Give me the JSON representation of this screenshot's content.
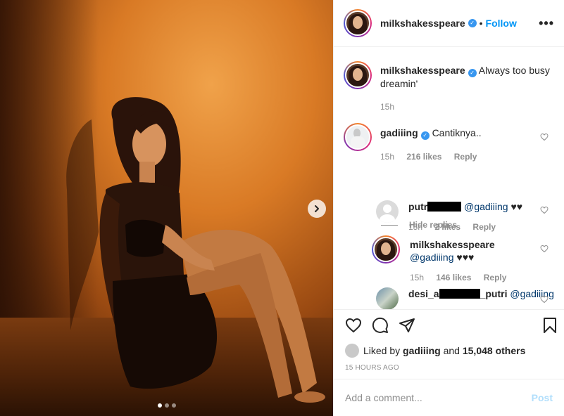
{
  "header": {
    "username": "milkshakesspeare",
    "separator": "•",
    "follow_label": "Follow",
    "more_label": "•••",
    "verified_glyph": "✓"
  },
  "caption": {
    "username": "milkshakesspeare",
    "text": "Always too busy dreamin'",
    "time": "15h"
  },
  "comments": [
    {
      "username": "gadiiing",
      "text": "Cantiknya..",
      "time": "15h",
      "likes": "216 likes",
      "reply_label": "Reply",
      "hide_replies_label": "Hide replies"
    }
  ],
  "replies": [
    {
      "username_prefix": "putr",
      "mention": "@gadiiing",
      "text": "♥♥",
      "time": "15h",
      "likes": "2 likes",
      "reply_label": "Reply"
    },
    {
      "username": "milkshakesspeare",
      "mention": "@gadiiing",
      "text": "♥♥♥",
      "time": "15h",
      "likes": "146 likes",
      "reply_label": "Reply"
    },
    {
      "username_prefix": "desi_a",
      "username_suffix": "_putri",
      "mention": "@gadiiing"
    }
  ],
  "likes": {
    "prefix": "Liked by",
    "user": "gadiiing",
    "and": "and",
    "count": "15,048 others"
  },
  "timestamp": "15 HOURS AGO",
  "add_comment": {
    "placeholder": "Add a comment...",
    "post_label": "Post"
  },
  "carousel": {
    "total": 3,
    "active": 1
  },
  "colors": {
    "accent": "#0095f6",
    "verified": "#3897f0",
    "muted": "#8e8e8e"
  },
  "icons": [
    "chevron-right-icon",
    "heart-icon",
    "comment-icon",
    "share-icon",
    "bookmark-icon",
    "more-icon",
    "verified-icon"
  ]
}
